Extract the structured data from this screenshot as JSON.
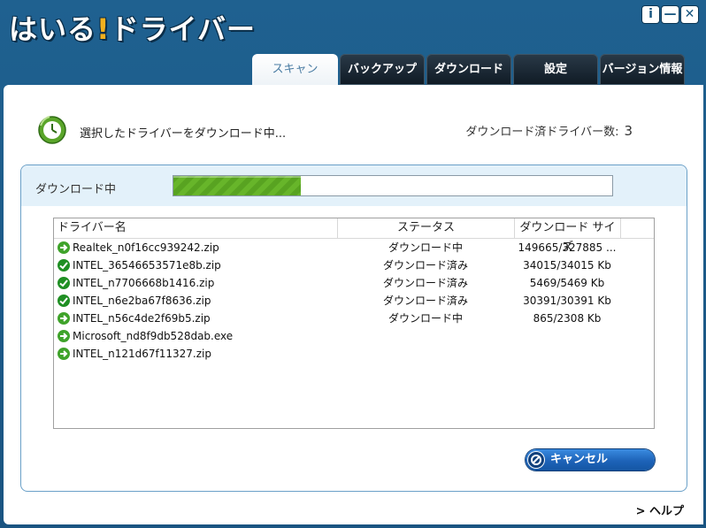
{
  "app": {
    "logo_text": "はいる",
    "logo_bang": "!",
    "logo_rest": "ドライバー"
  },
  "window_controls": {
    "info": "i",
    "minimize": "—",
    "close": "✕"
  },
  "tabs": [
    {
      "label": "スキャン",
      "active": true
    },
    {
      "label": "バックアップ",
      "active": false
    },
    {
      "label": "ダウンロード",
      "active": false
    },
    {
      "label": "設定",
      "active": false
    },
    {
      "label": "バージョン情報",
      "active": false
    }
  ],
  "status": {
    "text": "選択したドライバーをダウンロード中...",
    "count_label": "ダウンロード済ドライバー数:",
    "count_value": "3"
  },
  "download": {
    "label": "ダウンロード中",
    "progress": 0.29
  },
  "table": {
    "columns": [
      "ドライバー名",
      "ステータス",
      "ダウンロード サイズ"
    ],
    "rows": [
      {
        "icon": "arrow-right-icon",
        "name": "Realtek_n0f16cc939242.zip",
        "status": "ダウンロード中",
        "size": "149665/327885 ..."
      },
      {
        "icon": "check-icon",
        "name": "INTEL_36546653571e8b.zip",
        "status": "ダウンロード済み",
        "size": "34015/34015 Kb"
      },
      {
        "icon": "check-icon",
        "name": "INTEL_n7706668b1416.zip",
        "status": "ダウンロード済み",
        "size": "5469/5469 Kb"
      },
      {
        "icon": "check-icon",
        "name": "INTEL_n6e2ba67f8636.zip",
        "status": "ダウンロード済み",
        "size": "30391/30391 Kb"
      },
      {
        "icon": "arrow-right-icon",
        "name": "INTEL_n56c4de2f69b5.zip",
        "status": "ダウンロード中",
        "size": "865/2308 Kb"
      },
      {
        "icon": "arrow-right-icon",
        "name": "Microsoft_nd8f9db528dab.exe",
        "status": "",
        "size": ""
      },
      {
        "icon": "arrow-right-icon",
        "name": "INTEL_n121d67f11327.zip",
        "status": "",
        "size": ""
      }
    ]
  },
  "buttons": {
    "cancel": "キャンセル",
    "help": "> ヘルプ"
  },
  "colors": {
    "frame": "#1f6190",
    "accent": "#4a7ca3",
    "progress": "#58a321",
    "button": "#1d63b8"
  }
}
